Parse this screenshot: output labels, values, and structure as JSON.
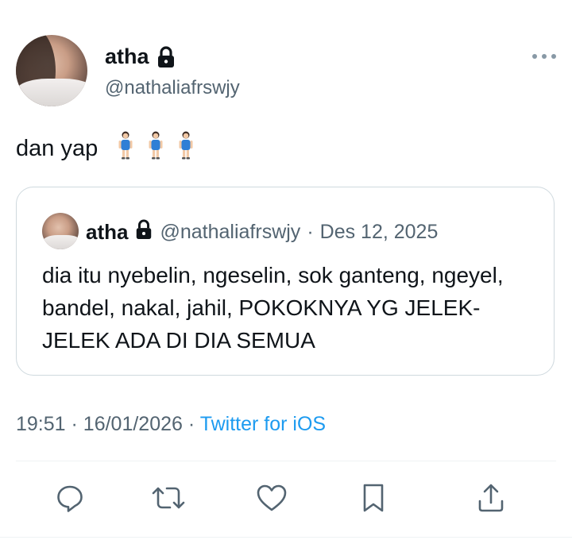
{
  "author": {
    "display_name": "atha",
    "handle": "@nathaliafrswjy",
    "protected": true
  },
  "tweet": {
    "text": "dan yap",
    "emojis": [
      "person-standing-emoji",
      "person-standing-emoji",
      "person-standing-emoji"
    ]
  },
  "quoted_tweet": {
    "display_name": "atha",
    "handle": "@nathaliafrswjy",
    "separator": "·",
    "date": "Des 12, 2025",
    "text": "dia itu nyebelin, ngeselin, sok ganteng, ngeyel, bandel, nakal, jahil, POKOKNYA YG JELEK-JELEK ADA DI DIA SEMUA"
  },
  "meta": {
    "time": "19:51",
    "sep1": "·",
    "date": "16/01/2026",
    "sep2": "·",
    "source": "Twitter for iOS"
  },
  "actions": [
    "reply-icon",
    "retweet-icon",
    "like-icon",
    "bookmark-icon",
    "share-icon"
  ],
  "colors": {
    "text_primary": "#0f1419",
    "text_secondary": "#536471",
    "link": "#1d9bf0",
    "border": "#cfd9de"
  }
}
